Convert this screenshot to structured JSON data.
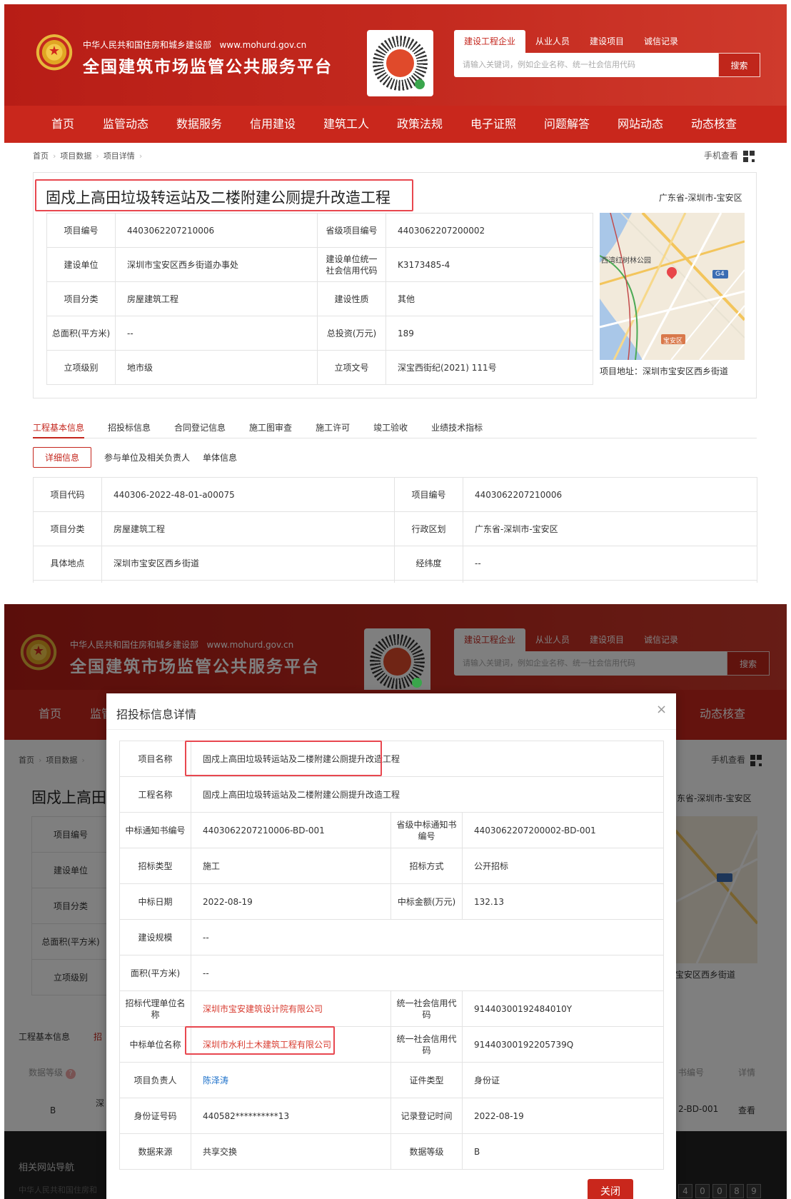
{
  "header": {
    "ministry": "中华人民共和国住房和城乡建设部",
    "url": "www.mohurd.gov.cn",
    "platform_title": "全国建筑市场监管公共服务平台",
    "search_tabs": [
      "建设工程企业",
      "从业人员",
      "建设项目",
      "诚信记录"
    ],
    "search_placeholder": "请输入关键词，例如企业名称、统一社会信用代码",
    "search_button": "搜索",
    "accent": "#c4261d"
  },
  "nav": [
    "首页",
    "监管动态",
    "数据服务",
    "信用建设",
    "建筑工人",
    "政策法规",
    "电子证照",
    "问题解答",
    "网站动态",
    "动态核查"
  ],
  "breadcrumb": [
    "首页",
    "项目数据",
    "项目详情"
  ],
  "mobile_view": "手机查看",
  "project": {
    "title": "固戍上高田垃圾转运站及二楼附建公厕提升改造工程",
    "region": "广东省-深圳市-宝安区",
    "address": "项目地址：深圳市宝安区西乡街道",
    "rows": [
      {
        "l1": "项目编号",
        "v1": "4403062207210006",
        "l2": "省级项目编号",
        "v2": "4403062207200002"
      },
      {
        "l1": "建设单位",
        "v1": "深圳市宝安区西乡街道办事处",
        "l2": "建设单位统一社会信用代码",
        "v2": "K3173485-4"
      },
      {
        "l1": "项目分类",
        "v1": "房屋建筑工程",
        "l2": "建设性质",
        "v2": "其他"
      },
      {
        "l1": "总面积(平方米)",
        "v1": "--",
        "l2": "总投资(万元)",
        "v2": "189"
      },
      {
        "l1": "立项级别",
        "v1": "地市级",
        "l2": "立项文号",
        "v2": "深宝西街纪(2021) 111号"
      }
    ]
  },
  "map": {
    "labels": [
      "西湾红树林公园",
      "宝安区",
      "G4"
    ]
  },
  "tabs": [
    "工程基本信息",
    "招投标信息",
    "合同登记信息",
    "施工图审查",
    "施工许可",
    "竣工验收",
    "业绩技术指标"
  ],
  "subtabs": [
    "详细信息",
    "参与单位及相关负责人",
    "单体信息"
  ],
  "detail_rows": [
    {
      "l1": "项目代码",
      "v1": "440306-2022-48-01-a00075",
      "l2": "项目编号",
      "v2": "4403062207210006"
    },
    {
      "l1": "项目分类",
      "v1": "房屋建筑工程",
      "l2": "行政区划",
      "v2": "广东省-深圳市-宝安区"
    },
    {
      "l1": "具体地点",
      "v1": "深圳市宝安区西乡街道",
      "l2": "经纬度",
      "v2": "--"
    }
  ],
  "screen2": {
    "title_partial": "固戍上高田",
    "region_partial": "东省-深圳市-宝安区",
    "address_partial": "宝安区西乡街道",
    "tabs_partial": [
      "工程基本信息",
      "招"
    ],
    "grade_label": "数据等级",
    "grade_value": "B",
    "red_partial": "深",
    "col_partial": "书编号",
    "detail_col": "详情",
    "code_partial": "2-BD-001",
    "view_link": "查看",
    "footer_title": "相关网站导航",
    "footer_text": "中华人民共和国住房和",
    "pages": [
      "4",
      "0",
      "0",
      "8",
      "9"
    ]
  },
  "modal": {
    "title": "招投标信息详情",
    "close_label": "关闭",
    "rows": [
      {
        "l1": "项目名称",
        "v1": "固戍上高田垃圾转运站及二楼附建公厕提升改造工程"
      },
      {
        "l1": "工程名称",
        "v1": "固戍上高田垃圾转运站及二楼附建公厕提升改造工程"
      },
      {
        "l1": "中标通知书编号",
        "v1": "4403062207210006-BD-001",
        "l2": "省级中标通知书编号",
        "v2": "4403062207200002-BD-001"
      },
      {
        "l1": "招标类型",
        "v1": "施工",
        "l2": "招标方式",
        "v2": "公开招标"
      },
      {
        "l1": "中标日期",
        "v1": "2022-08-19",
        "l2": "中标金额(万元)",
        "v2": "132.13"
      },
      {
        "l1": "建设规模",
        "v1": "--"
      },
      {
        "l1": "面积(平方米)",
        "v1": "--"
      },
      {
        "l1": "招标代理单位名称",
        "v1": "深圳市宝安建筑设计院有限公司",
        "l2": "统一社会信用代码",
        "v2": "91440300192484010Y"
      },
      {
        "l1": "中标单位名称",
        "v1": "深圳市水利土木建筑工程有限公司",
        "l2": "统一社会信用代码",
        "v2": "91440300192205739Q"
      },
      {
        "l1": "项目负责人",
        "v1": "陈泽涛",
        "l2": "证件类型",
        "v2": "身份证"
      },
      {
        "l1": "身份证号码",
        "v1": "440582**********13",
        "l2": "记录登记时间",
        "v2": "2022-08-19"
      },
      {
        "l1": "数据来源",
        "v1": "共享交换",
        "l2": "数据等级",
        "v2": "B"
      }
    ]
  }
}
